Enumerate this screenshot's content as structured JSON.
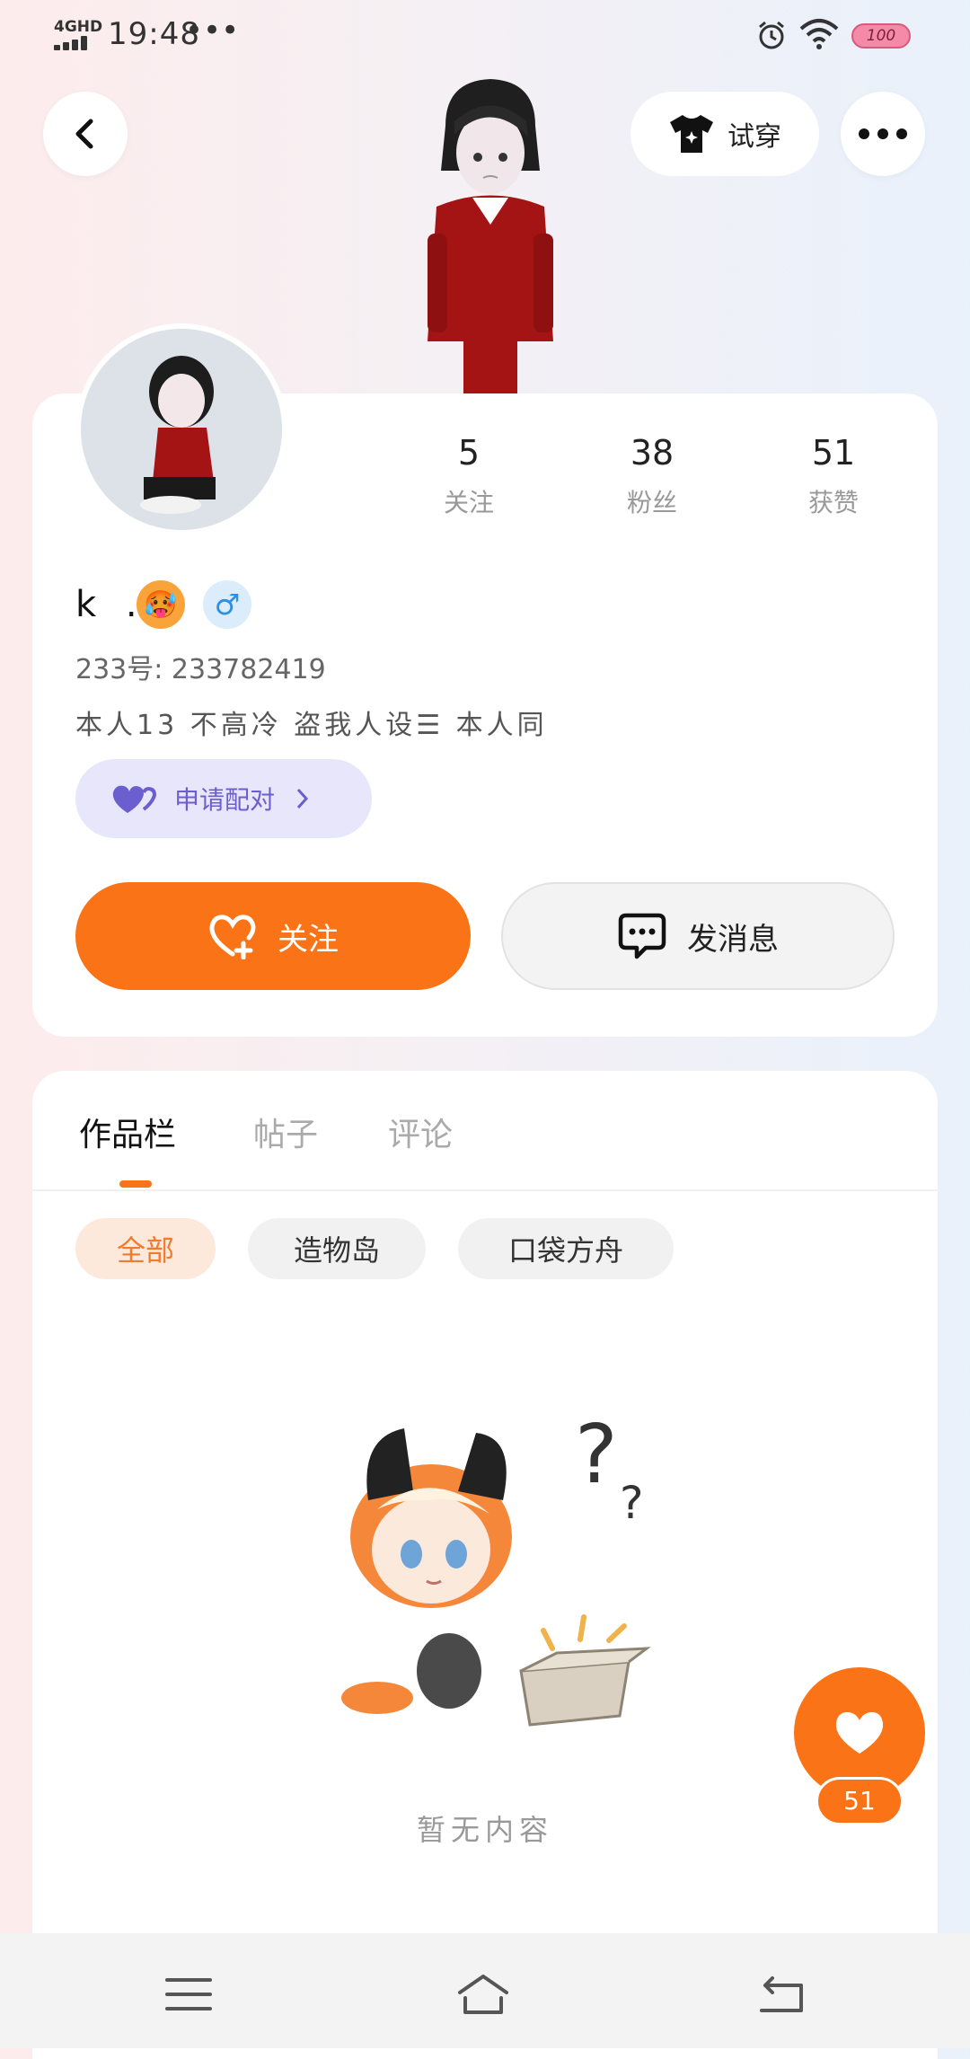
{
  "status_bar": {
    "network": "4GHD",
    "time": "19:48",
    "more": "•••",
    "battery": "100"
  },
  "header": {
    "try_on_label": "试穿"
  },
  "profile": {
    "name": "k .",
    "emoji": "🥵",
    "gender_symbol": "♂",
    "uid": "233号: 233782419",
    "bio": "本人13 不高冷 盗我人设☰ 本人同",
    "pair_label": "申请配对",
    "stats": [
      {
        "value": "5",
        "label": "关注"
      },
      {
        "value": "38",
        "label": "粉丝"
      },
      {
        "value": "51",
        "label": "获赞"
      }
    ]
  },
  "actions": {
    "follow_label": "关注",
    "message_label": "发消息"
  },
  "tabs": [
    {
      "label": "作品栏",
      "active": true
    },
    {
      "label": "帖子",
      "active": false
    },
    {
      "label": "评论",
      "active": false
    }
  ],
  "filters": [
    {
      "label": "全部",
      "active": true
    },
    {
      "label": "造物岛",
      "active": false
    },
    {
      "label": "口袋方舟",
      "active": false
    }
  ],
  "empty_state": {
    "text": "暂无内容"
  },
  "like_fab": {
    "count": "51"
  },
  "colors": {
    "accent": "#fa7316",
    "pair_bg": "#e7e6fb",
    "pair_fg": "#6b5fd0",
    "gender": "#2f8fe0"
  },
  "icons": {
    "back": "chevron-left-icon",
    "try_on": "tshirt-icon",
    "more": "more-dots-icon",
    "pair": "hearts-icon",
    "follow": "heart-plus-icon",
    "message": "chat-bubble-icon",
    "like": "heart-icon"
  }
}
